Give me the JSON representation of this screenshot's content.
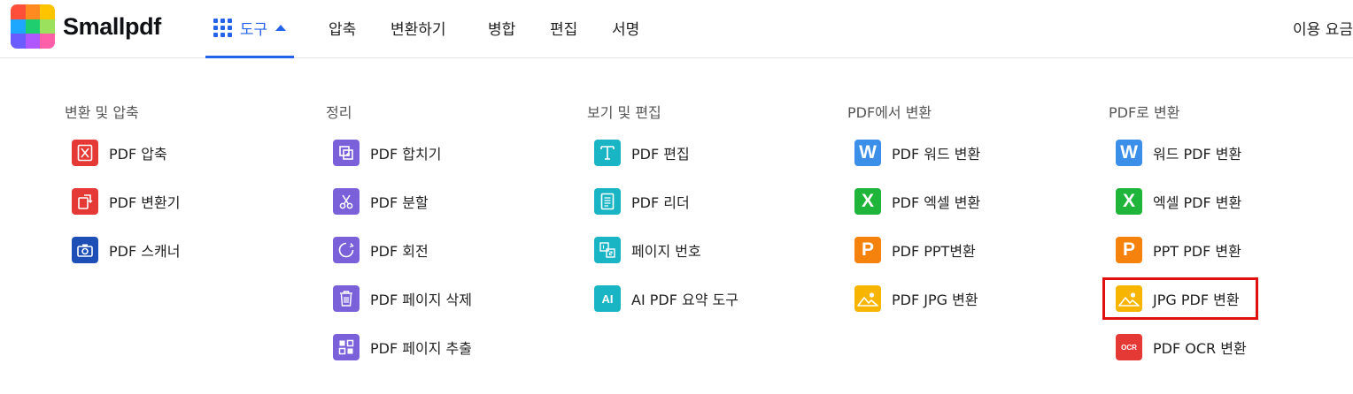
{
  "header": {
    "logo_text": "Smallpdf",
    "tools_label": "도구",
    "nav": [
      "압축",
      "변환하기",
      "병합",
      "편집",
      "서명"
    ],
    "pricing_label": "이용 요금"
  },
  "menu": {
    "columns": [
      {
        "title": "변환 및 압축",
        "items": [
          {
            "label": "PDF 압축",
            "icon": "compress-icon"
          },
          {
            "label": "PDF 변환기",
            "icon": "convert-icon"
          },
          {
            "label": "PDF 스캐너",
            "icon": "camera-icon"
          }
        ]
      },
      {
        "title": "정리",
        "items": [
          {
            "label": "PDF 합치기",
            "icon": "merge-icon"
          },
          {
            "label": "PDF 분할",
            "icon": "scissors-icon"
          },
          {
            "label": "PDF 회전",
            "icon": "rotate-icon"
          },
          {
            "label": "PDF 페이지 삭제",
            "icon": "trash-icon"
          },
          {
            "label": "PDF 페이지 추출",
            "icon": "extract-pages-icon"
          }
        ]
      },
      {
        "title": "보기 및 편집",
        "items": [
          {
            "label": "PDF 편집",
            "icon": "text-edit-icon"
          },
          {
            "label": "PDF 리더",
            "icon": "document-reader-icon"
          },
          {
            "label": "페이지 번호",
            "icon": "page-number-icon"
          },
          {
            "label": "AI PDF 요약 도구",
            "icon": "ai-icon",
            "icon_text": "AI"
          }
        ]
      },
      {
        "title": "PDF에서 변환",
        "items": [
          {
            "label": "PDF 워드 변환",
            "icon": "word-icon",
            "icon_text": "W"
          },
          {
            "label": "PDF 엑셀 변환",
            "icon": "excel-icon",
            "icon_text": "X"
          },
          {
            "label": "PDF PPT변환",
            "icon": "powerpoint-icon",
            "icon_text": "P"
          },
          {
            "label": "PDF JPG 변환",
            "icon": "image-icon"
          }
        ]
      },
      {
        "title": "PDF로 변환",
        "items": [
          {
            "label": "워드 PDF 변환",
            "icon": "word-icon",
            "icon_text": "W"
          },
          {
            "label": "엑셀 PDF 변환",
            "icon": "excel-icon",
            "icon_text": "X"
          },
          {
            "label": "PPT PDF 변환",
            "icon": "powerpoint-icon",
            "icon_text": "P"
          },
          {
            "label": "JPG PDF 변환",
            "icon": "image-icon",
            "highlighted": true
          },
          {
            "label": "PDF OCR 변환",
            "icon": "ocr-icon",
            "icon_text": "OCR"
          }
        ]
      }
    ]
  },
  "colors": {
    "accent": "#2563eb",
    "highlight_border": "#e01010",
    "red": "#e53935",
    "purple": "#7b61d9",
    "teal": "#19b5c4",
    "blue": "#3b8fe8",
    "green": "#1fb53a",
    "orange": "#f5820d",
    "yellow": "#f7b500",
    "navy": "#1d4fb7"
  }
}
